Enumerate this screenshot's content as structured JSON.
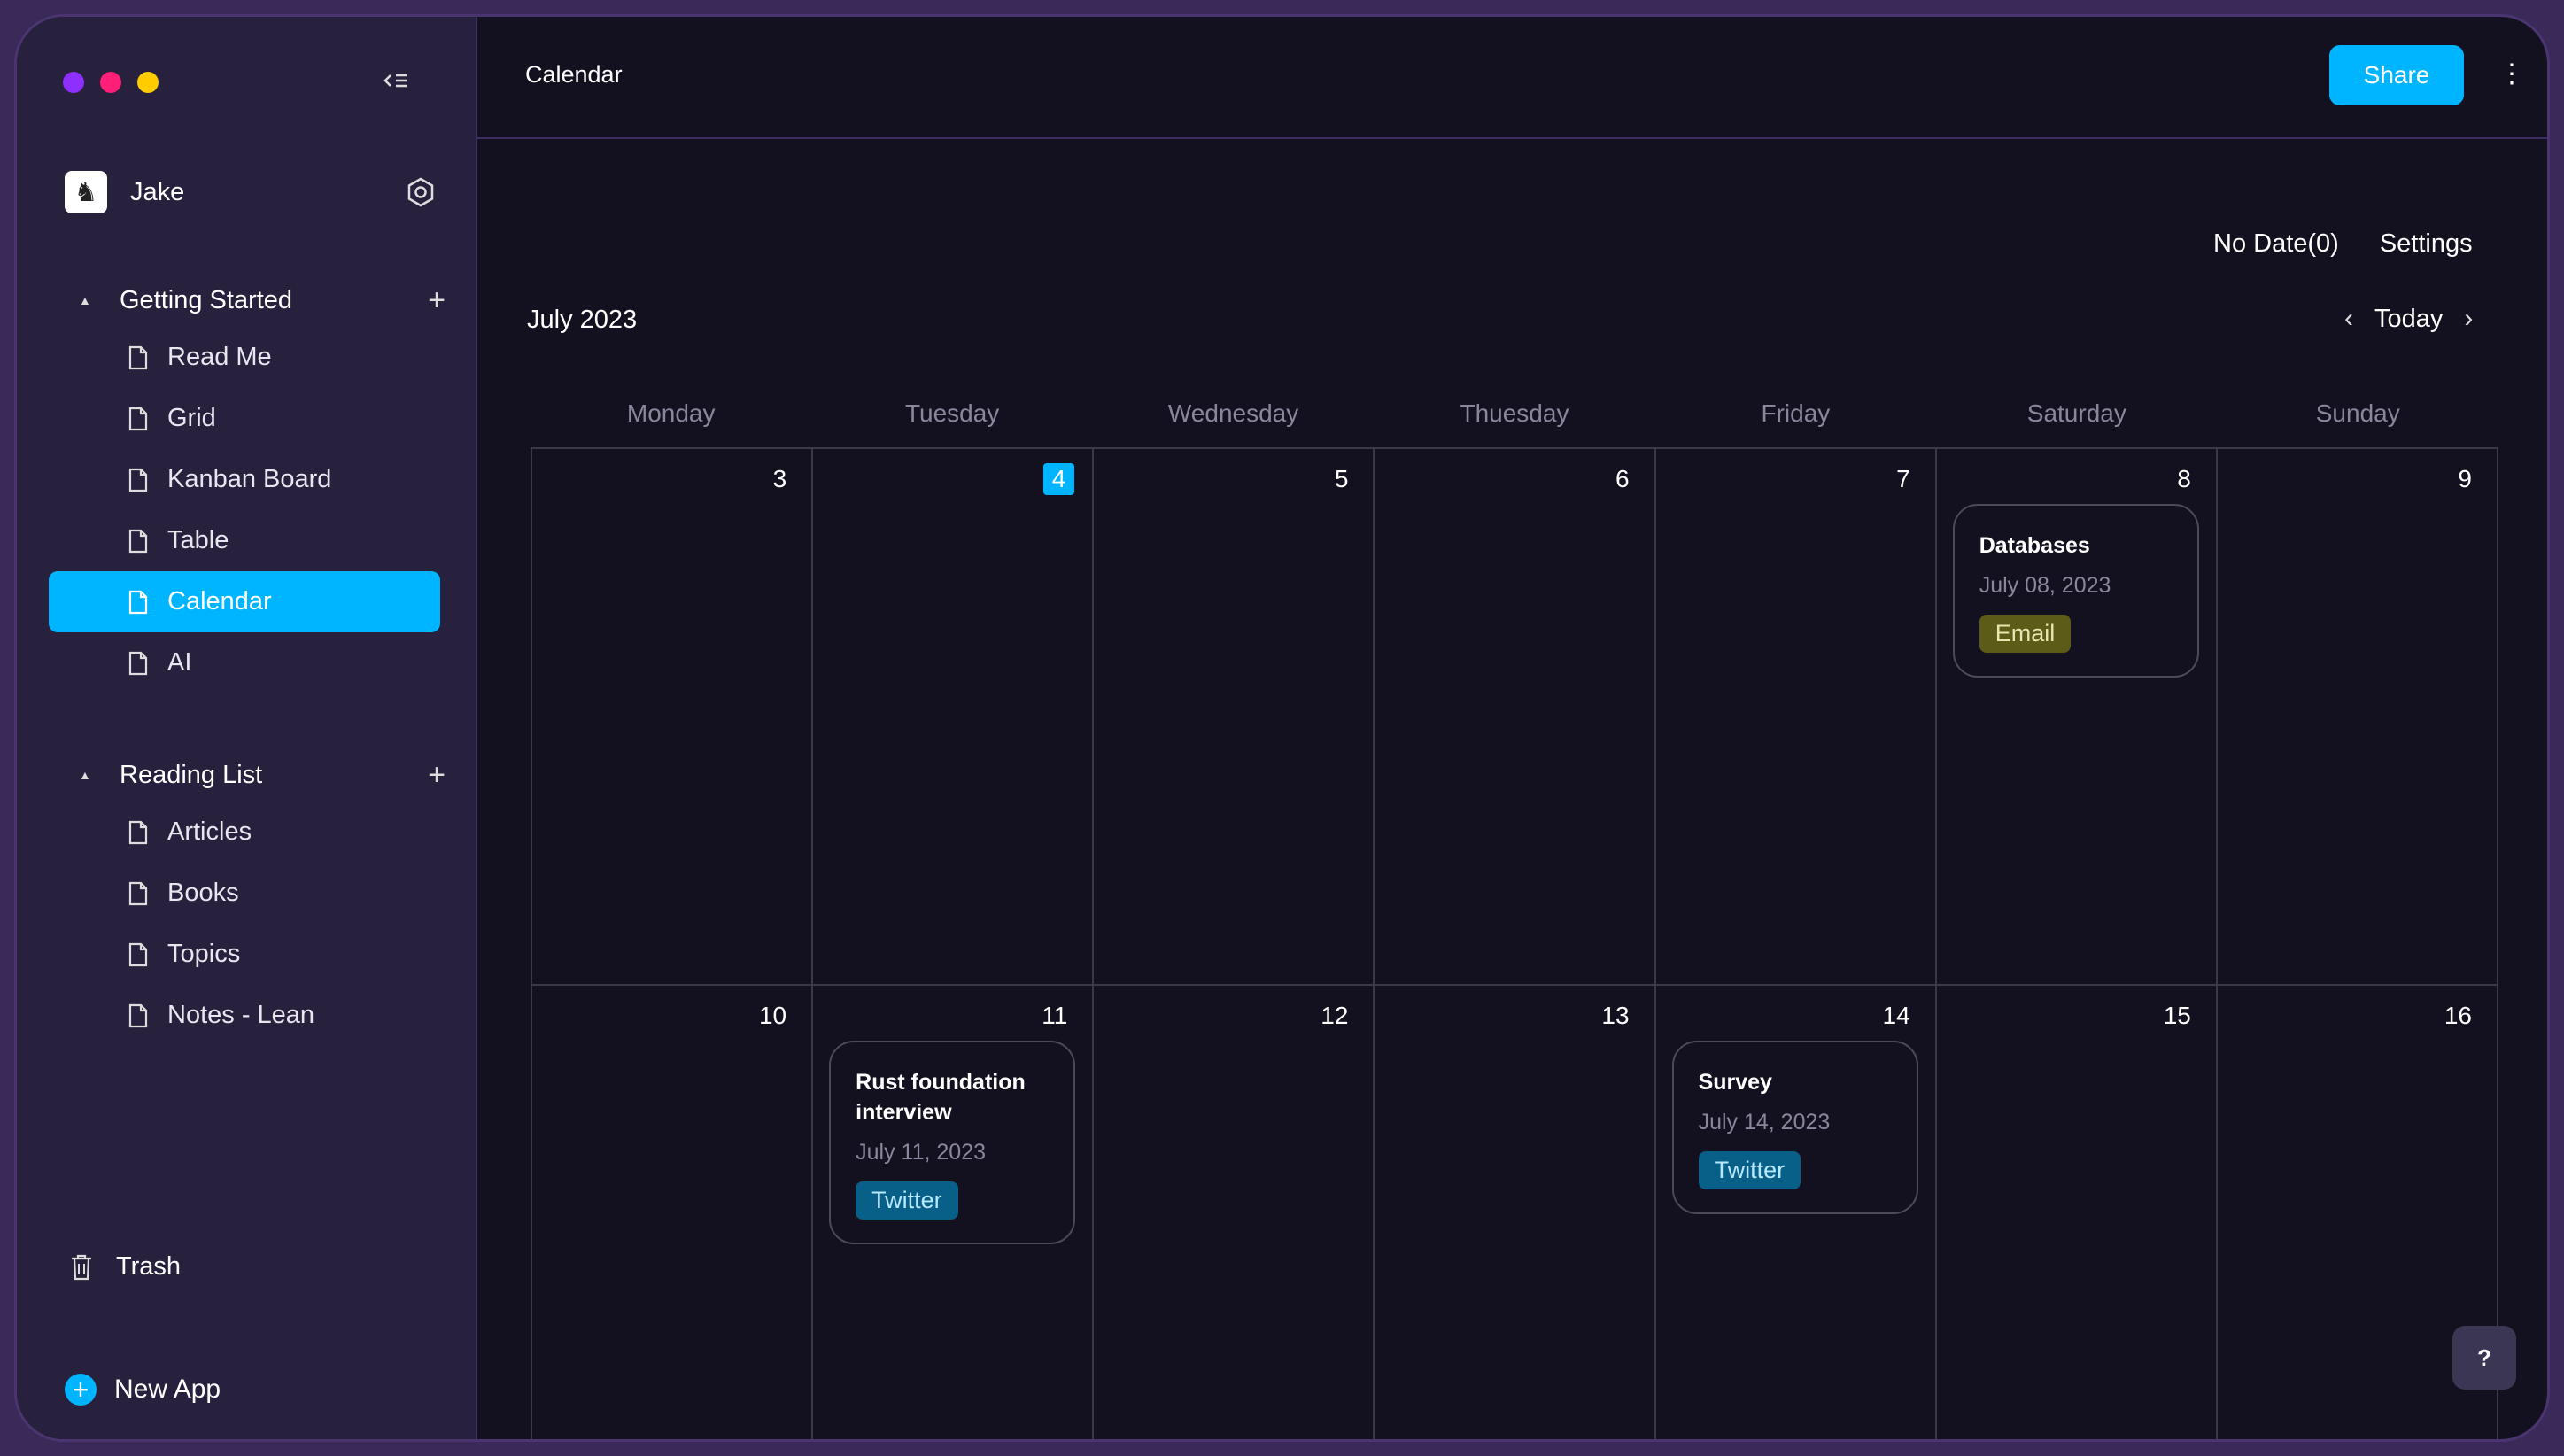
{
  "window": {
    "traffic_colors": [
      "#8e2eff",
      "#ff1e78",
      "#ffcc00"
    ]
  },
  "sidebar": {
    "user": {
      "name": "Jake"
    },
    "sections": [
      {
        "title": "Getting Started",
        "items": [
          {
            "label": "Read Me"
          },
          {
            "label": "Grid"
          },
          {
            "label": "Kanban Board"
          },
          {
            "label": "Table"
          },
          {
            "label": "Calendar",
            "active": true
          },
          {
            "label": "AI"
          }
        ]
      },
      {
        "title": "Reading List",
        "items": [
          {
            "label": "Articles"
          },
          {
            "label": "Books"
          },
          {
            "label": "Topics"
          },
          {
            "label": "Notes - Lean"
          }
        ]
      }
    ],
    "trash_label": "Trash",
    "new_app_label": "New App"
  },
  "header": {
    "title": "Calendar",
    "share_label": "Share"
  },
  "calendar": {
    "no_date_label": "No Date(0)",
    "settings_label": "Settings",
    "month_label": "July 2023",
    "today_label": "Today",
    "weekdays": [
      "Monday",
      "Tuesday",
      "Wednesday",
      "Thuesday",
      "Friday",
      "Saturday",
      "Sunday"
    ],
    "weeks": [
      [
        "3",
        "4",
        "5",
        "6",
        "7",
        "8",
        "9"
      ],
      [
        "10",
        "11",
        "12",
        "13",
        "14",
        "15",
        "16"
      ]
    ],
    "today_day": "4",
    "events": [
      {
        "title": "Databases",
        "date": "July 08, 2023",
        "tag": "Email",
        "tag_type": "email"
      },
      {
        "title": "Rust foundation interview",
        "date": "July 11, 2023",
        "tag": "Twitter",
        "tag_type": "twitter"
      },
      {
        "title": "Survey",
        "date": "July 14, 2023",
        "tag": "Twitter",
        "tag_type": "twitter"
      }
    ]
  },
  "help_label": "?"
}
